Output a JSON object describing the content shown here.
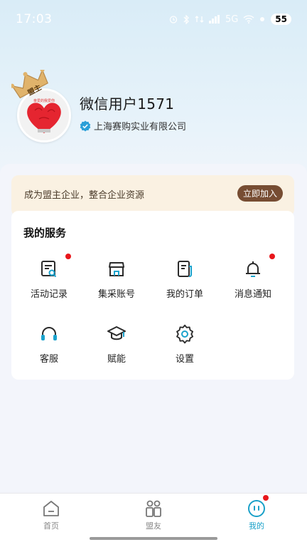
{
  "status_bar": {
    "time": "17:03",
    "network": "5G",
    "battery": "55"
  },
  "profile": {
    "badge": "盟主",
    "name": "微信用户1571",
    "company": "上海赛购实业有限公司"
  },
  "promo": {
    "text": "成为盟主企业，整合企业资源",
    "button": "立即加入"
  },
  "services": {
    "title": "我的服务",
    "items": [
      {
        "label": "活动记录",
        "icon": "activity-record-icon",
        "notify": true
      },
      {
        "label": "集采账号",
        "icon": "store-icon",
        "notify": false
      },
      {
        "label": "我的订单",
        "icon": "order-icon",
        "notify": false
      },
      {
        "label": "消息通知",
        "icon": "bell-icon",
        "notify": true
      },
      {
        "label": "客服",
        "icon": "headset-icon",
        "notify": false
      },
      {
        "label": "赋能",
        "icon": "graduation-cap-icon",
        "notify": false
      },
      {
        "label": "设置",
        "icon": "gear-icon",
        "notify": false
      }
    ]
  },
  "bottom_nav": [
    {
      "label": "首页",
      "icon": "home-icon",
      "active": false
    },
    {
      "label": "盟友",
      "icon": "allies-icon",
      "active": false
    },
    {
      "label": "我的",
      "icon": "profile-face-icon",
      "active": true,
      "notify": true
    }
  ],
  "colors": {
    "accent": "#19a0c8",
    "promo_bg": "#faf1e2",
    "join_button": "#774d33",
    "notify_dot": "#e8161b"
  }
}
